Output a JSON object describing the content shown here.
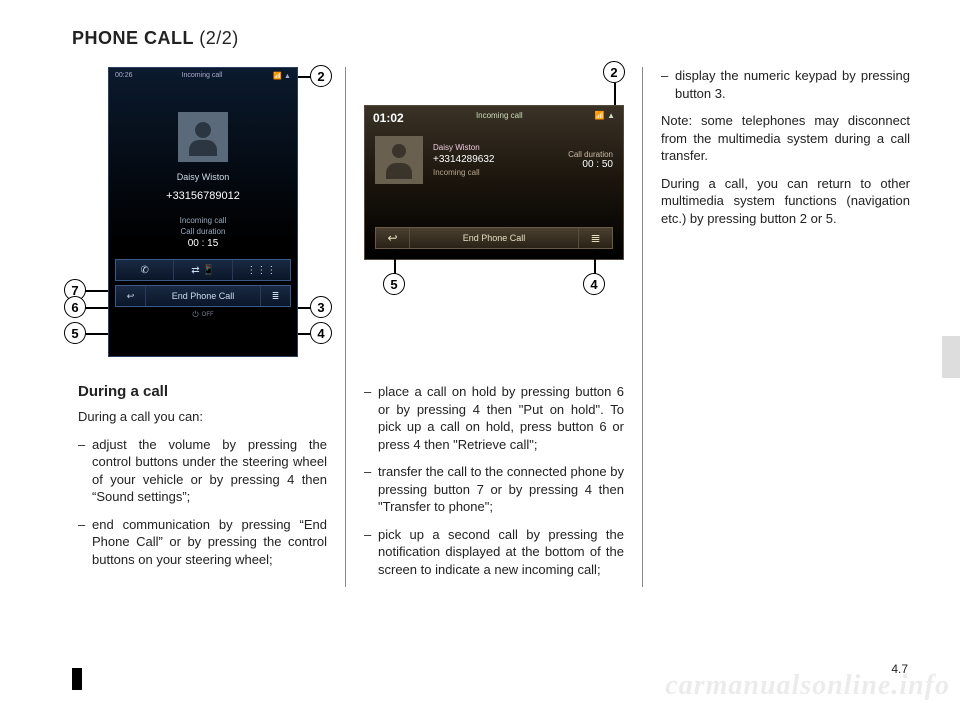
{
  "title_main": "PHONE CALL",
  "title_part": "(2/2)",
  "page_number": "4.7",
  "watermark": "carmanualsonline.info",
  "fig1": {
    "clock": "00:26",
    "header": "Incoming call",
    "contact_name": "Daisy Wiston",
    "phone_number": "+33156789012",
    "status": "Incoming call",
    "duration_label": "Call duration",
    "duration_value": "00 : 15",
    "row1": {
      "hangup_icon": "✆",
      "transfer_icon": "⇄ 📱",
      "keypad_icon": "⋮⋮⋮"
    },
    "row2": {
      "back_icon": "↩",
      "end_label": "End Phone Call",
      "menu_icon": "≣"
    },
    "off_label": "OFF",
    "callouts": {
      "c2": "2",
      "c3": "3",
      "c4": "4",
      "c5": "5",
      "c6": "6",
      "c7": "7"
    }
  },
  "fig2": {
    "clock": "01:02",
    "header": "Incoming call",
    "contact_name": "Daisy Wiston",
    "phone_number": "+3314289632",
    "status": "Incoming call",
    "duration_label": "Call duration",
    "duration_value": "00 : 50",
    "bar": {
      "back_icon": "↩",
      "end_label": "End Phone Call",
      "menu_icon": "≣"
    },
    "callouts": {
      "c2": "2",
      "c4": "4",
      "c5": "5"
    }
  },
  "col1": {
    "heading": "During a call",
    "intro": "During a call you can:",
    "b1": "adjust the volume by pressing the control buttons under the steering wheel of your vehicle or by pressing 4 then “Sound settings”;",
    "b2": "end communication by pressing “End Phone Call” or by pressing the control buttons on your steering wheel;"
  },
  "col2": {
    "b1": "place a call on hold by pressing button 6 or by pressing 4 then \"Put on hold\". To pick up a call on hold, press button 6 or press 4 then \"Retrieve call\";",
    "b2": "transfer the call to the connected phone by pressing button 7 or by pressing 4 then \"Transfer to phone\";",
    "b3": "pick up a second call by pressing the notification displayed at the bottom of the screen to indicate a new incoming call;"
  },
  "col3": {
    "b1": "display the numeric keypad by pressing button 3.",
    "note": "Note: some telephones may disconnect from the multimedia system during a call transfer.",
    "p1": "During a call, you can return to other multimedia system functions (navigation etc.) by pressing button 2 or 5."
  }
}
